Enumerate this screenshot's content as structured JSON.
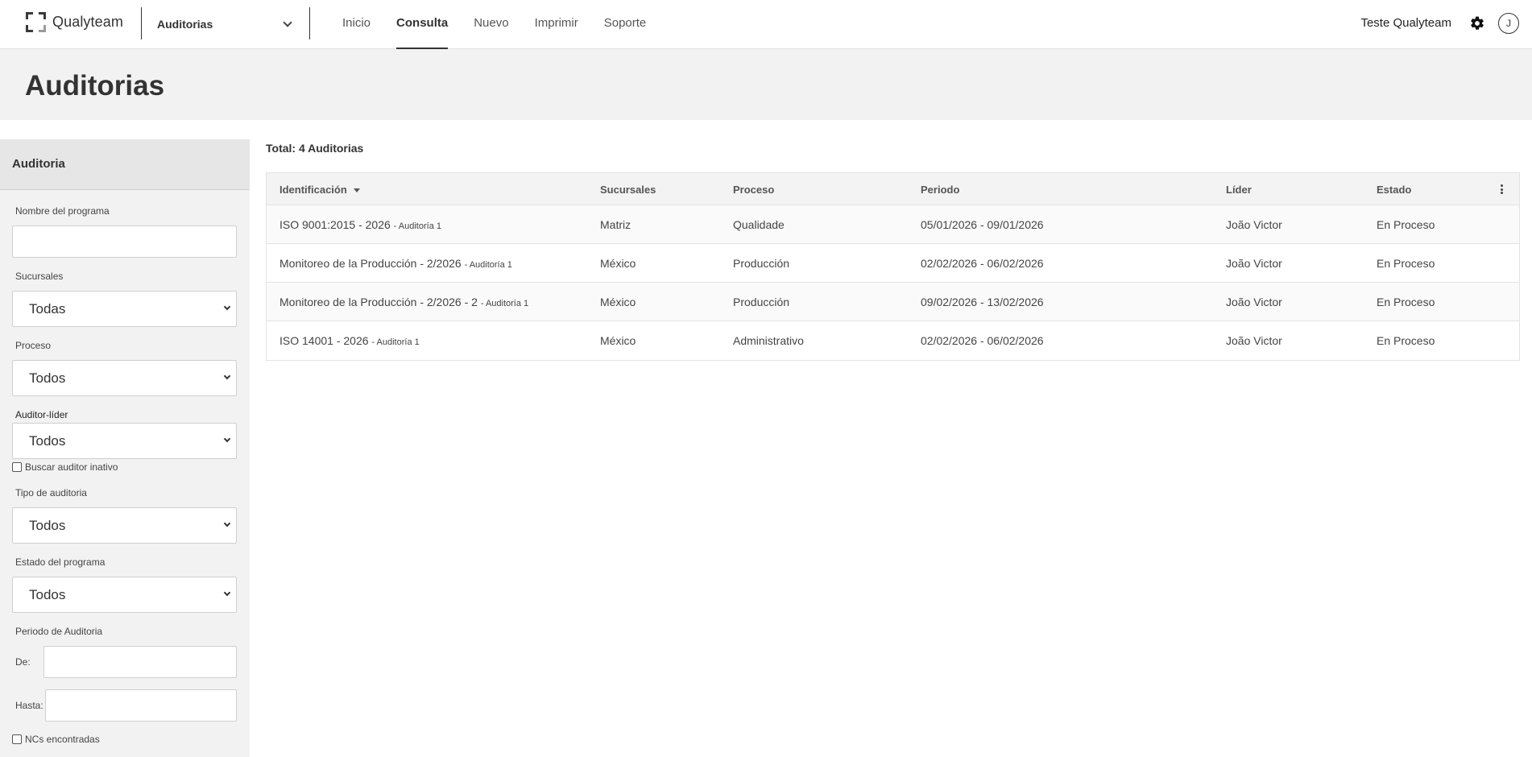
{
  "topbar": {
    "brand": "Qualyteam",
    "module": "Auditorias",
    "nav": [
      "Inicio",
      "Consulta",
      "Nuevo",
      "Imprimir",
      "Soporte"
    ],
    "active_nav": "Consulta",
    "user_name": "Teste Qualyteam",
    "avatar_initial": "J"
  },
  "page": {
    "title": "Auditorias"
  },
  "filters": {
    "header": "Auditoria",
    "program_name_label": "Nombre del programa",
    "program_name_value": "",
    "branches_label": "Sucursales",
    "branches_value": "Todas",
    "process_label": "Proceso",
    "process_value": "Todos",
    "lead_auditor_label": "Auditor-líder",
    "lead_auditor_value": "Todos",
    "inactive_auditor_label": "Buscar auditor inativo",
    "audit_type_label": "Tipo de auditoria",
    "audit_type_value": "Todos",
    "program_status_label": "Estado del programa",
    "program_status_value": "Todos",
    "period_label": "Periodo de Auditoria",
    "from_label": "De:",
    "from_value": "",
    "to_label": "Hasta:",
    "to_value": "",
    "ncs_found_label": "NCs encontradas"
  },
  "results": {
    "total": "Total: 4 Auditorias",
    "columns": {
      "id": "Identificación",
      "branches": "Sucursales",
      "process": "Proceso",
      "period": "Periodo",
      "leader": "Líder",
      "status": "Estado"
    },
    "rows": [
      {
        "id": "ISO 9001:2015 - 2026",
        "sub": "- Auditoría 1",
        "branch": "Matriz",
        "process": "Qualidade",
        "period": "05/01/2026 - 09/01/2026",
        "leader": "João Victor",
        "status": "En Proceso"
      },
      {
        "id": "Monitoreo de la Producción - 2/2026",
        "sub": "- Auditoría 1",
        "branch": "México",
        "process": "Producción",
        "period": "02/02/2026 - 06/02/2026",
        "leader": "João Victor",
        "status": "En Proceso"
      },
      {
        "id": "Monitoreo de la Producción - 2/2026 - 2",
        "sub": "- Auditoría 1",
        "branch": "México",
        "process": "Producción",
        "period": "09/02/2026 - 13/02/2026",
        "leader": "João Victor",
        "status": "En Proceso"
      },
      {
        "id": "ISO 14001 - 2026",
        "sub": "- Auditoría 1",
        "branch": "México",
        "process": "Administrativo",
        "period": "02/02/2026 - 06/02/2026",
        "leader": "João Victor",
        "status": "En Proceso"
      }
    ]
  },
  "icons": {
    "logo": "qualyteam-logo-icon",
    "module_chevron": "chevron-down-icon",
    "settings": "gear-icon",
    "sort": "sort-desc-icon",
    "table_menu": "kebab-menu-icon"
  }
}
